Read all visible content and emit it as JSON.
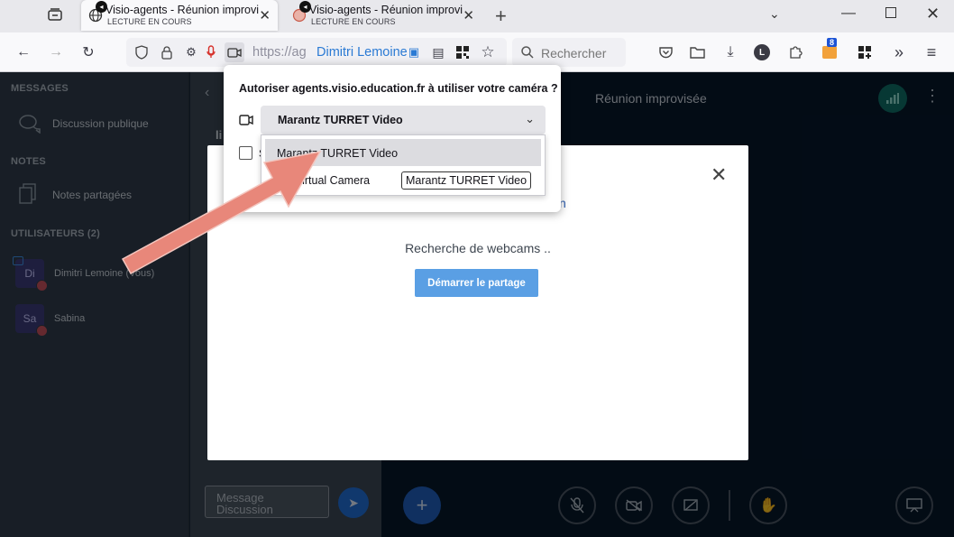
{
  "browser": {
    "tabs": [
      {
        "title": "Visio-agents - Réunion improvisée",
        "subtitle": "LECTURE EN COURS",
        "active": true
      },
      {
        "title": "Visio-agents - Réunion improvisée",
        "subtitle": "LECTURE EN COURS",
        "active": false
      }
    ],
    "new_tab_glyph": "+",
    "url": "https://ag",
    "url_user": "Dimitri Lemoine",
    "search_placeholder": "Rechercher",
    "badge_count": "8",
    "profile_letter": "L"
  },
  "sidebar": {
    "sections": [
      {
        "header": "MESSAGES",
        "items": [
          "Discussion publique"
        ]
      },
      {
        "header": "NOTES",
        "items": [
          "Notes partagées"
        ]
      },
      {
        "header": "UTILISATEURS (2)",
        "items": []
      }
    ],
    "users": [
      {
        "initials": "Di",
        "name": "Dimitri Lemoine (Vous)"
      },
      {
        "initials": "Sa",
        "name": "Sabina"
      }
    ]
  },
  "chat": {
    "input_placeholder": "Message Discussion",
    "partial_header": "li"
  },
  "meeting": {
    "title": "Réunion improvisée",
    "accent": "#0f6b64"
  },
  "modal": {
    "status": "Recherche de webcams ..",
    "share_button": "Démarrer le partage",
    "cut_title": "n"
  },
  "permission": {
    "question": "Autoriser agents.visio.education.fr à utiliser votre caméra ?",
    "selected_device": "Marantz TURRET Video",
    "checkbox_label": "S",
    "options": [
      "Marantz TURRET Video",
      "Virtual Camera"
    ],
    "tooltip": "Marantz TURRET Video"
  },
  "annotation_color": "#e8877a"
}
